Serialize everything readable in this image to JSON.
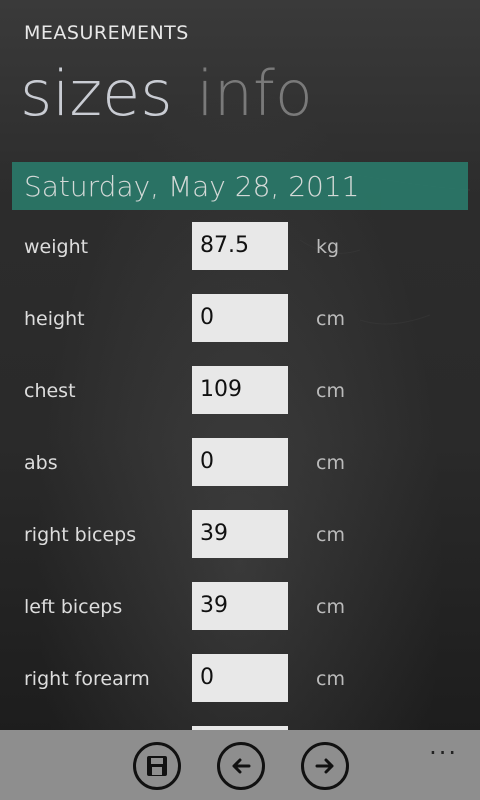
{
  "app": {
    "title": "MEASUREMENTS"
  },
  "pivot": {
    "active": "sizes",
    "inactive": "info"
  },
  "date": "Saturday, May 28, 2011",
  "rows": [
    {
      "label": "weight",
      "value": "87.5",
      "unit": "kg"
    },
    {
      "label": "height",
      "value": "0",
      "unit": "cm"
    },
    {
      "label": "chest",
      "value": "109",
      "unit": "cm"
    },
    {
      "label": "abs",
      "value": "0",
      "unit": "cm"
    },
    {
      "label": "right biceps",
      "value": "39",
      "unit": "cm"
    },
    {
      "label": "left biceps",
      "value": "39",
      "unit": "cm"
    },
    {
      "label": "right forearm",
      "value": "0",
      "unit": "cm"
    },
    {
      "label": "",
      "value": "",
      "unit": ""
    }
  ],
  "appbar": {
    "icons": [
      "save-icon",
      "back-arrow-icon",
      "forward-arrow-icon"
    ],
    "more": "..."
  },
  "colors": {
    "accent": "#2a7a6a",
    "appbar": "#8e8e8e"
  }
}
